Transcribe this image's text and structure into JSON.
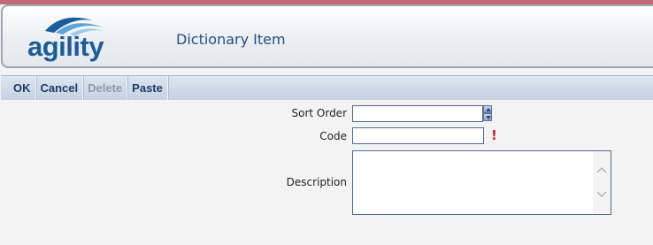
{
  "header": {
    "logo_text": "agility",
    "page_title": "Dictionary Item"
  },
  "toolbar": {
    "ok": "OK",
    "cancel": "Cancel",
    "delete": "Delete",
    "paste": "Paste"
  },
  "form": {
    "sort_order": {
      "label": "Sort Order",
      "value": ""
    },
    "code": {
      "label": "Code",
      "value": "",
      "required_mark": "!"
    },
    "description": {
      "label": "Description",
      "value": ""
    }
  },
  "colors": {
    "brand": "#1a5d9c",
    "accent": "#c56a74",
    "required": "#d62020"
  },
  "icons": [
    "agility-logo-wave",
    "spinner-up-icon",
    "spinner-down-icon",
    "required-icon",
    "scroll-up-icon",
    "scroll-down-icon"
  ]
}
